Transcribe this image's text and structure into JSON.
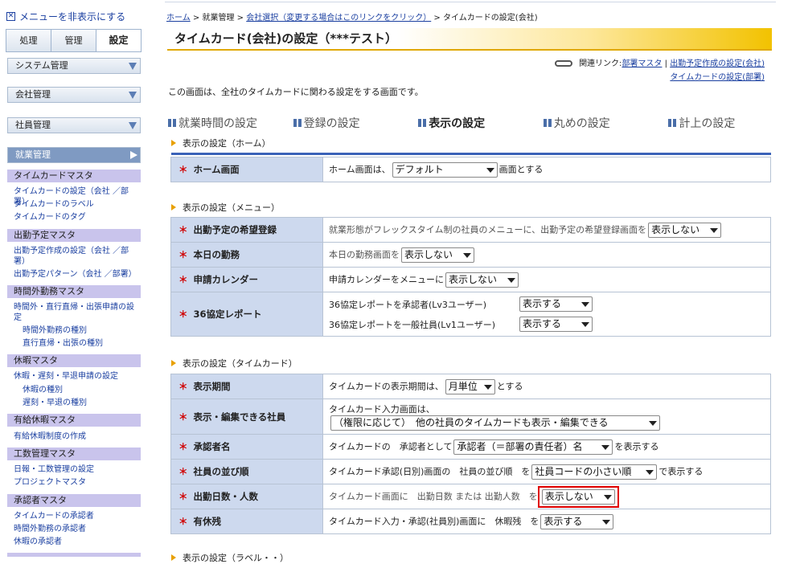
{
  "sidebar": {
    "hide_menu": "メニューを非表示にする",
    "tabs": [
      "処理",
      "管理",
      "設定"
    ],
    "sections": [
      "システム管理",
      "会社管理",
      "社員管理",
      "就業管理"
    ],
    "groups": [
      {
        "title": "タイムカードマスタ",
        "links": [
          {
            "t": "タイムカードの設定（会社 ／部署）"
          },
          {
            "t": "タイムカードのラベル"
          },
          {
            "t": "タイムカードのタグ"
          }
        ]
      },
      {
        "title": "出勤予定マスタ",
        "links": [
          {
            "t": "出勤予定作成の設定（会社 ／部"
          },
          {
            "t": "署）"
          },
          {
            "t": "出勤予定パターン（会社 ／部署）"
          }
        ]
      },
      {
        "title": "時間外勤務マスタ",
        "links": [
          {
            "t": "時間外・直行直帰・出張申請の設"
          },
          {
            "t": "定"
          },
          {
            "t": "時間外勤務の種別"
          },
          {
            "t": "直行直帰・出張の種別"
          }
        ]
      },
      {
        "title": "休暇マスタ",
        "links": [
          {
            "t": "休暇・遅刻・早退申請の設定"
          },
          {
            "t": "休暇の種別"
          },
          {
            "t": "遅刻・早退の種別"
          }
        ]
      },
      {
        "title": "有給休暇マスタ",
        "links": [
          {
            "t": "有給休暇制度の作成"
          }
        ]
      },
      {
        "title": "工数管理マスタ",
        "links": [
          {
            "t": "日報・工数管理の設定"
          },
          {
            "t": "プロジェクトマスタ"
          }
        ]
      },
      {
        "title": "承認者マスタ",
        "links": [
          {
            "t": "タイムカードの承認者"
          },
          {
            "t": "時間外勤務の承認者"
          },
          {
            "t": "休暇の承認者"
          }
        ]
      }
    ]
  },
  "breadcrumb": {
    "home": "ホーム",
    "sep": ">",
    "work": "就業管理",
    "company": "会社選択（変更する場合はこのリンクをクリック）",
    "current": "タイムカードの設定(会社)"
  },
  "page_title": "タイムカード(会社)の設定（***テスト）",
  "related": {
    "label": "関連リンク:",
    "link1": "部署マスタ",
    "sep": "|",
    "link2": "出勤予定作成の設定(会社)",
    "link3": "タイムカードの設定(部署)"
  },
  "description": "この画面は、全社のタイムカードに関わる設定をする画面です。",
  "nav_tabs": [
    "就業時間の設定",
    "登録の設定",
    "表示の設定",
    "丸めの設定",
    "計上の設定"
  ],
  "sections": {
    "home": "表示の設定（ホーム）",
    "menu": "表示の設定（メニュー）",
    "timecard": "表示の設定（タイムカード）",
    "next": "表示の設定（ラベル・・）"
  },
  "home_rows": {
    "r1_label": "ホーム画面",
    "r1_pre": "ホーム画面は、",
    "r1_sel": "デフォルト",
    "r1_post": "画面とする"
  },
  "menu_rows": {
    "r1_label": "出勤予定の希望登録",
    "r1_text": "就業形態がフレックスタイム制の社員のメニューに、出勤予定の希望登録画面を",
    "r1_sel": "表示しない",
    "r2_label": "本日の勤務",
    "r2_text": "本日の勤務画面を",
    "r2_sel": "表示しない",
    "r3_label": "申請カレンダー",
    "r3_text": "申請カレンダーをメニューに",
    "r3_sel": "表示しない",
    "r4_label": "36協定レポート",
    "r4_text1": "36協定レポートを承認者(Lv3ユーザー)",
    "r4_sel1": "表示する",
    "r4_text2": "36協定レポートを一般社員(Lv1ユーザー)",
    "r4_sel2": "表示する"
  },
  "tc_rows": {
    "r1_label": "表示期間",
    "r1_pre": "タイムカードの表示期間は、",
    "r1_sel": "月単位",
    "r1_post": "とする",
    "r2_label": "表示・編集できる社員",
    "r2_text": "タイムカード入力画面は、",
    "r2_sel": "（権限に応じて）　他の社員のタイムカードも表示・編集できる",
    "r3_label": "承認者名",
    "r3_pre": "タイムカードの　承認者として",
    "r3_sel": "承認者（＝部署の責任者）名",
    "r3_post": "を表示する",
    "r4_label": "社員の並び順",
    "r4_pre": "タイムカード承認(日別)画面の　社員の並び順　を",
    "r4_sel": "社員コードの小さい順",
    "r4_post": "で表示する",
    "r5_label": "出勤日数・人数",
    "r5_pre": "タイムカード画面に　出勤日数 または 出勤人数　を",
    "r5_sel": "表示しない",
    "r6_label": "有休残",
    "r6_pre": "タイムカード入力・承認(社員別)画面に　休暇残　を",
    "r6_sel": "表示する"
  },
  "req_mark": "＊"
}
